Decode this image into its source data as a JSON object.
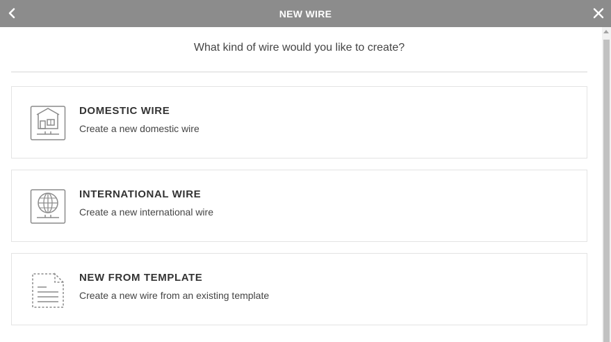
{
  "header": {
    "title": "NEW WIRE",
    "back_icon": "chevron-left-icon",
    "close_icon": "close-icon"
  },
  "prompt": "What kind of wire would you like to create?",
  "options": [
    {
      "title": "DOMESTIC WIRE",
      "description": "Create a new domestic wire",
      "icon": "house-document-icon"
    },
    {
      "title": "INTERNATIONAL WIRE",
      "description": "Create a new international wire",
      "icon": "globe-document-icon"
    },
    {
      "title": "NEW FROM TEMPLATE",
      "description": "Create a new wire from an existing template",
      "icon": "template-document-icon"
    }
  ],
  "colors": {
    "header_bg": "#8c8c8c",
    "header_text": "#ffffff",
    "card_border": "#e3e3e3",
    "icon_stroke": "#8a8a8a"
  }
}
